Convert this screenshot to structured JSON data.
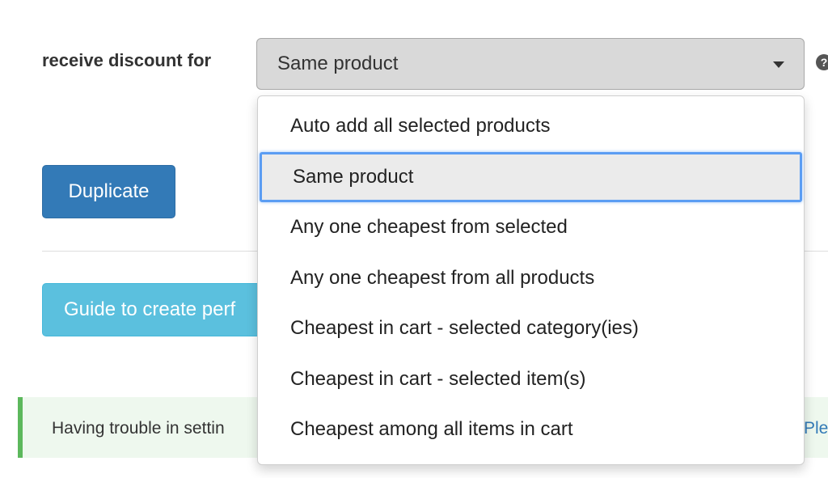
{
  "form": {
    "label": "receive discount for",
    "select_value": "Same product",
    "help_icon": "?"
  },
  "buttons": {
    "duplicate": "Duplicate",
    "guide": "Guide to create perf"
  },
  "alert": {
    "text": "Having trouble in settin",
    "link": "Plea"
  },
  "dropdown": {
    "options": [
      "Auto add all selected products",
      "Same product",
      "Any one cheapest from selected",
      "Any one cheapest from all products",
      "Cheapest in cart - selected category(ies)",
      "Cheapest in cart - selected item(s)",
      "Cheapest among all items in cart"
    ],
    "selected_index": 1
  },
  "colors": {
    "primary": "#337ab7",
    "info": "#5bc0de",
    "success_border": "#5cb85c",
    "focus": "#5b9df3"
  }
}
